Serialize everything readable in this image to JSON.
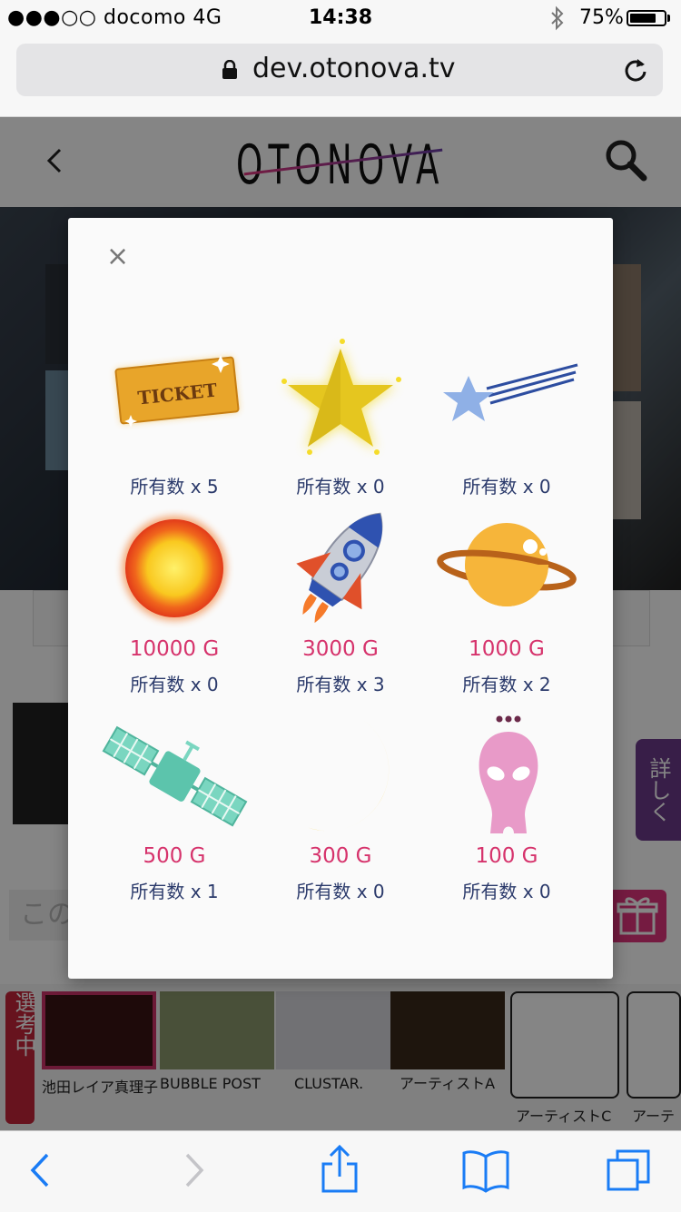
{
  "status_bar": {
    "carrier": "●●●○○ docomo  4G",
    "time": "14:38",
    "battery_percent": "75%"
  },
  "browser": {
    "url": "dev.otonova.tv"
  },
  "site": {
    "logo": "OTONOVA",
    "detail_label": "詳しく",
    "comment_placeholder": "この",
    "selected_label": "選考中"
  },
  "artists": [
    {
      "name": "池田レイア真理子"
    },
    {
      "name": "BUBBLE POST"
    },
    {
      "name": "CLUSTAR."
    },
    {
      "name": "アーティストA"
    },
    {
      "name": "アーティストC"
    },
    {
      "name": "アーテ"
    }
  ],
  "modal": {
    "close_label": "×",
    "items": [
      {
        "icon": "ticket-icon",
        "price": "",
        "owned": "所有数 x 5"
      },
      {
        "icon": "star-icon",
        "price": "",
        "owned": "所有数 x 0"
      },
      {
        "icon": "shooting-star-icon",
        "price": "",
        "owned": "所有数 x 0"
      },
      {
        "icon": "sun-icon",
        "price": "10000 G",
        "owned": "所有数 x 0"
      },
      {
        "icon": "rocket-icon",
        "price": "3000 G",
        "owned": "所有数 x 3"
      },
      {
        "icon": "planet-icon",
        "price": "1000 G",
        "owned": "所有数 x 2"
      },
      {
        "icon": "satellite-icon",
        "price": "500 G",
        "owned": "所有数 x 1"
      },
      {
        "icon": "moon-icon",
        "price": "300 G",
        "owned": "所有数 x 0"
      },
      {
        "icon": "alien-icon",
        "price": "100 G",
        "owned": "所有数 x 0"
      }
    ]
  },
  "colors": {
    "price": "#d6336c",
    "owned": "#2b3a6b",
    "accent_pink": "#e0357e",
    "ios_blue": "#1a7cf5"
  }
}
